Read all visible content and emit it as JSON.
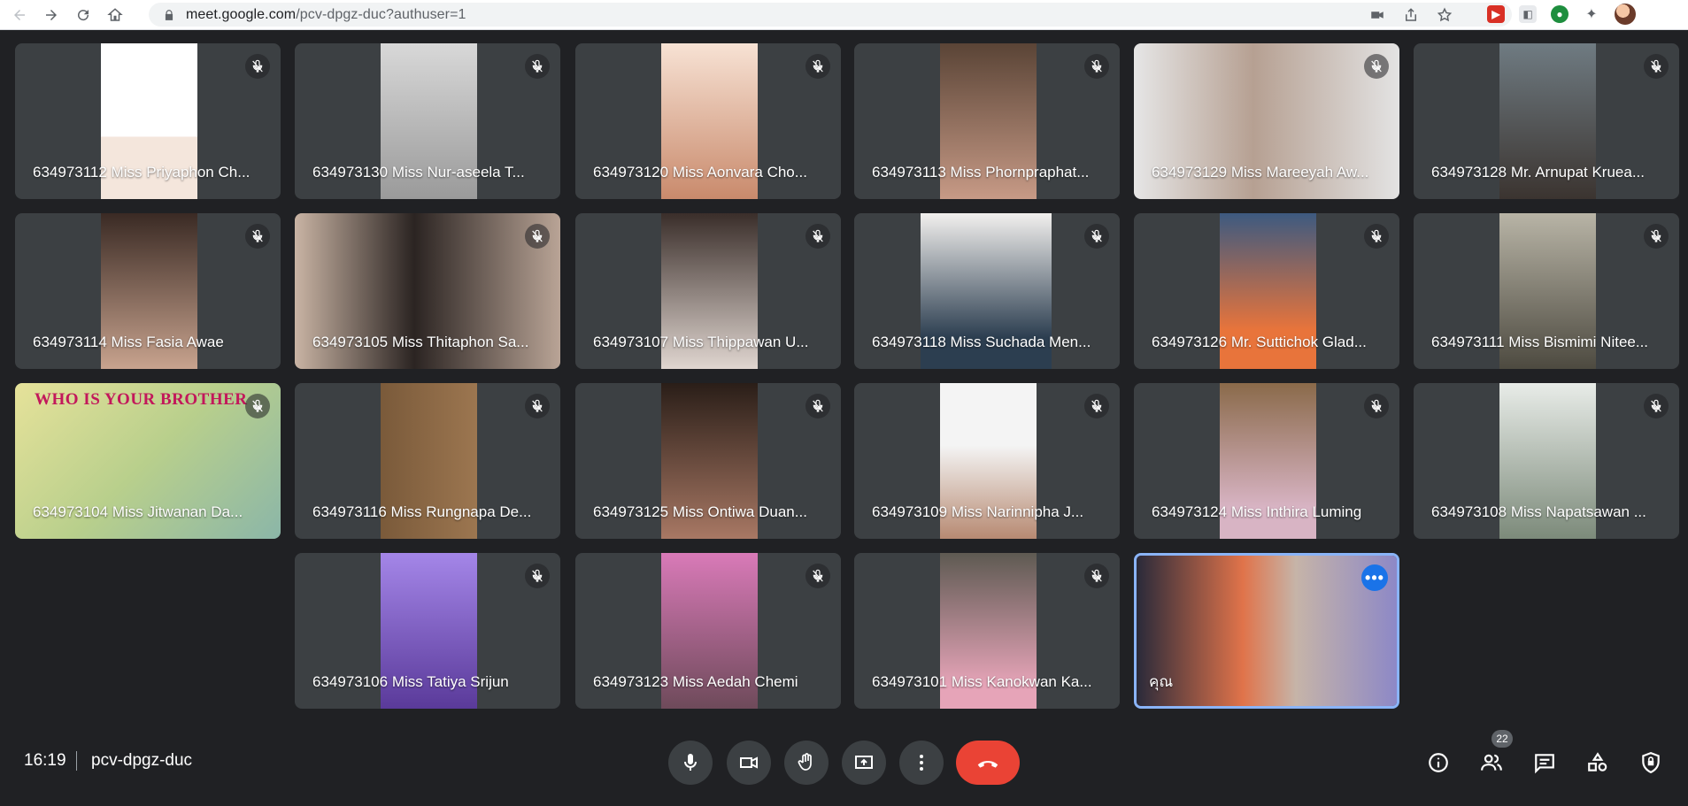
{
  "browser": {
    "url_host": "meet.google.com",
    "url_path": "/pcv-dpgz-duc?authuser=1"
  },
  "colors": {
    "meet_background": "#202124",
    "tile_background": "#3c4043",
    "end_call": "#ea4335",
    "self_border": "#8ab4f8",
    "accent": "#1a73e8"
  },
  "participants": [
    {
      "name": "634973112 Miss Priyaphon Ch...",
      "muted": true
    },
    {
      "name": "634973130 Miss Nur-aseela T...",
      "muted": true
    },
    {
      "name": "634973120 Miss Aonvara Cho...",
      "muted": true
    },
    {
      "name": "634973113 Miss Phornpraphat...",
      "muted": true
    },
    {
      "name": "634973129 Miss Mareeyah Aw...",
      "muted": true
    },
    {
      "name": "634973128 Mr. Arnupat Kruea...",
      "muted": true
    },
    {
      "name": "634973114 Miss Fasia Awae",
      "muted": true
    },
    {
      "name": "634973105 Miss Thitaphon Sa...",
      "muted": true
    },
    {
      "name": "634973107 Miss Thippawan U...",
      "muted": true
    },
    {
      "name": "634973118 Miss Suchada Men...",
      "muted": true
    },
    {
      "name": "634973126 Mr. Suttichok Glad...",
      "muted": true
    },
    {
      "name": "634973111 Miss Bismimi Nitee...",
      "muted": true
    },
    {
      "name": "634973104 Miss Jitwanan Da...",
      "muted": true,
      "banner": "WHO IS YOUR BROTHER"
    },
    {
      "name": "634973116 Miss Rungnapa De...",
      "muted": true
    },
    {
      "name": "634973125 Miss Ontiwa Duan...",
      "muted": true
    },
    {
      "name": "634973109 Miss Narinnipha J...",
      "muted": true
    },
    {
      "name": "634973124 Miss Inthira Luming",
      "muted": true
    },
    {
      "name": "634973108 Miss Napatsawan ...",
      "muted": true
    },
    {
      "name": "634973106 Miss Tatiya Srijun",
      "muted": true
    },
    {
      "name": "634973123 Miss Aedah Chemi",
      "muted": true
    },
    {
      "name": "634973101 Miss Kanokwan Ka...",
      "muted": true
    },
    {
      "name": "คุณ",
      "muted": false,
      "self": true
    }
  ],
  "bottom_bar": {
    "time": "16:19",
    "meeting_code": "pcv-dpgz-duc",
    "participant_count": "22",
    "controls": [
      "mic-icon",
      "camera-icon",
      "raise-hand-icon",
      "present-icon",
      "more-options-icon",
      "end-call-icon"
    ],
    "right_icons": [
      "info-icon",
      "people-icon",
      "chat-icon",
      "activities-icon",
      "host-controls-icon"
    ]
  }
}
